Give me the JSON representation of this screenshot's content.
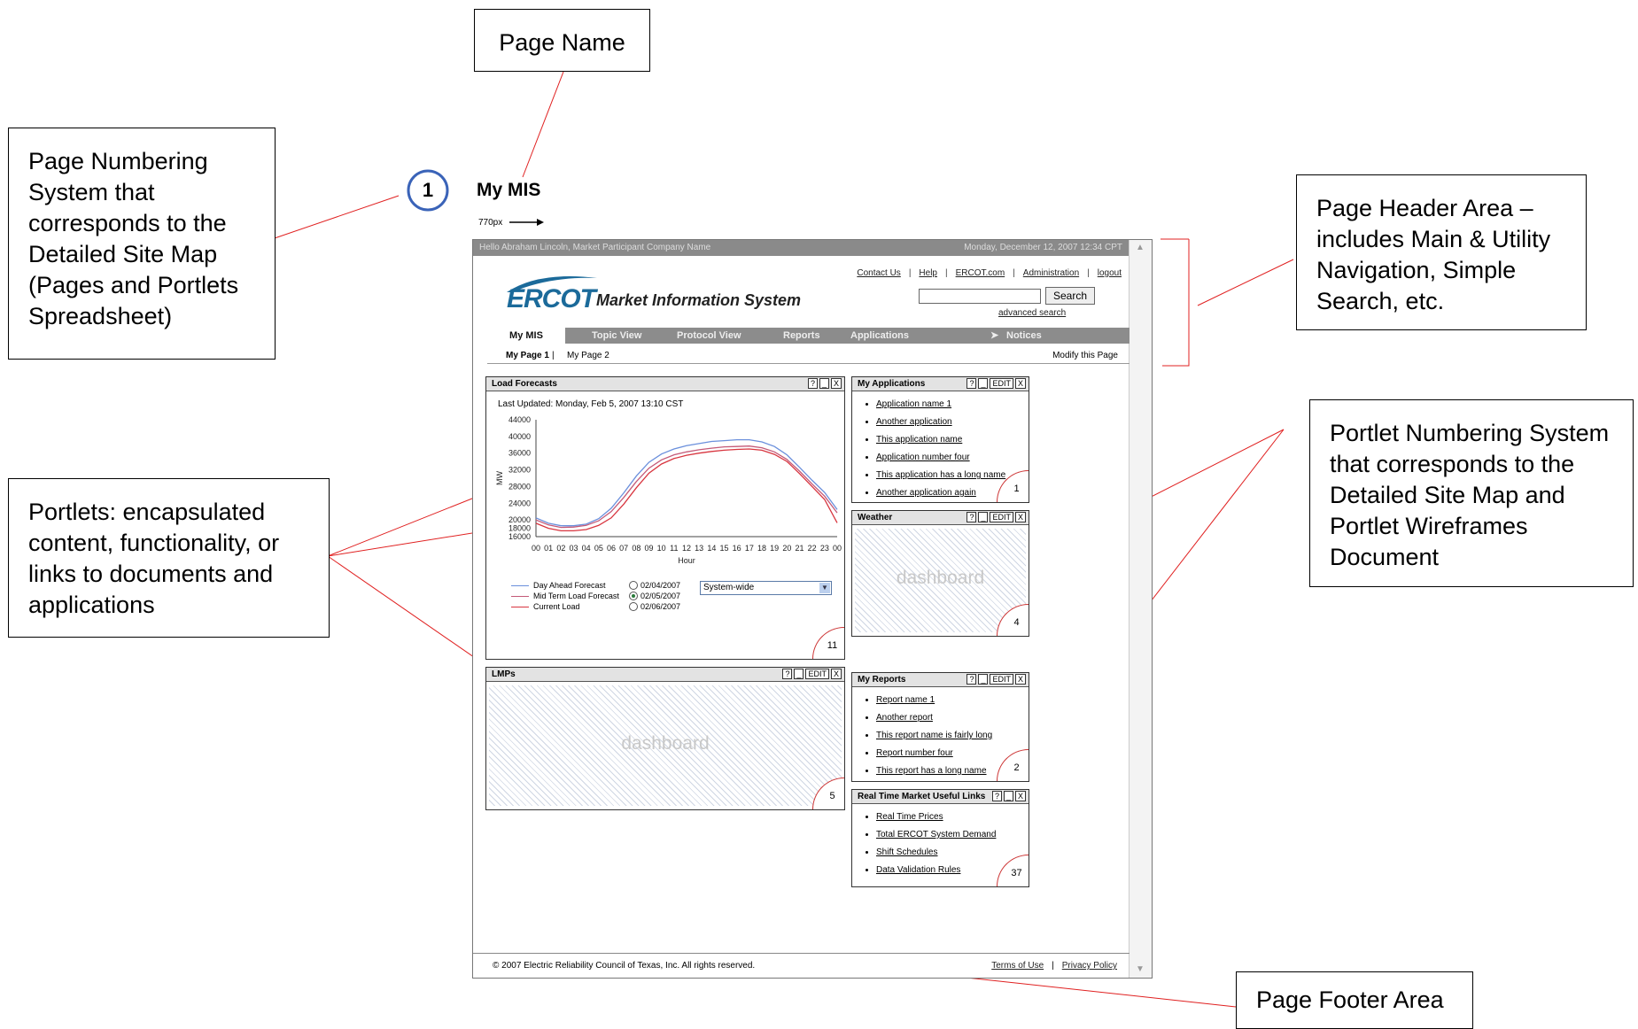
{
  "annotations": {
    "page_name": "Page Name",
    "page_numbering": "Page Numbering System that corresponds to the Detailed Site Map (Pages and Portlets Spreadsheet)",
    "page_header_area": "Page Header Area – includes Main & Utility Navigation, Simple Search, etc.",
    "portlets": "Portlets: encapsulated content, functionality, or links to documents and applications",
    "portlet_numbering": "Portlet Numbering System that corresponds to the Detailed Site Map and Portlet Wireframes Document",
    "page_footer_area": "Page Footer Area"
  },
  "page": {
    "number": "1",
    "title": "My MIS",
    "width_label": "770px"
  },
  "topbar": {
    "greeting": "Hello Abraham Lincoln, Market Participant Company Name",
    "datetime": "Monday, December 12, 2007   12:34 CPT"
  },
  "utility_nav": [
    "Contact Us",
    "Help",
    "ERCOT.com",
    "Administration",
    "logout"
  ],
  "search": {
    "button": "Search",
    "advanced": "advanced search",
    "value": ""
  },
  "logo": {
    "name": "ERCOT",
    "subtitle": "Market Information System"
  },
  "main_nav": {
    "items": [
      "My MIS",
      "Topic View",
      "Protocol View",
      "Reports",
      "Applications"
    ],
    "notices": "Notices",
    "active": "My MIS"
  },
  "sub_nav": {
    "page1": "My Page 1",
    "separator": "|",
    "page2": "My Page 2",
    "modify": "Modify this Page"
  },
  "portlets": {
    "load_forecasts": {
      "title": "Load Forecasts",
      "last_updated": "Last Updated: Monday, Feb 5, 2007  13:10 CST",
      "number": "11",
      "dates": [
        "02/04/2007",
        "02/05/2007",
        "02/06/2007"
      ],
      "selected_date": "02/05/2007",
      "region": "System-wide"
    },
    "lmps": {
      "title": "LMPs",
      "placeholder": "dashboard",
      "number": "5"
    },
    "my_applications": {
      "title": "My Applications",
      "number": "1",
      "items": [
        "Application name 1",
        "Another application",
        "This application name",
        "Application number four",
        "This application has a long name",
        "Another application again"
      ]
    },
    "weather": {
      "title": "Weather",
      "placeholder": "dashboard",
      "number": "4"
    },
    "my_reports": {
      "title": "My Reports",
      "number": "2",
      "items": [
        "Report name 1",
        "Another report",
        "This report name is fairly long",
        "Report number four",
        "This report has a long name"
      ]
    },
    "rtm_links": {
      "title": "Real Time Market Useful Links",
      "number": "37",
      "items": [
        "Real Time Prices",
        "Total ERCOT System Demand",
        "Shift Schedules",
        "Data Validation Rules"
      ]
    },
    "buttons": {
      "help": "?",
      "min": "_",
      "edit": "EDIT",
      "close": "X"
    }
  },
  "chart_data": {
    "type": "line",
    "xlabel": "Hour",
    "ylabel": "MW",
    "x": [
      "00",
      "01",
      "02",
      "03",
      "04",
      "05",
      "06",
      "07",
      "08",
      "09",
      "10",
      "11",
      "12",
      "13",
      "14",
      "15",
      "16",
      "17",
      "18",
      "19",
      "20",
      "21",
      "22",
      "23",
      "00"
    ],
    "ylim": [
      16000,
      44000
    ],
    "yticks": [
      16000,
      18000,
      20000,
      24000,
      28000,
      32000,
      36000,
      40000,
      44000
    ],
    "series": [
      {
        "name": "Day Ahead Forecast",
        "color": "#6a8fdc",
        "values": [
          20500,
          19200,
          18600,
          18600,
          19000,
          20300,
          22800,
          26500,
          30500,
          33800,
          35800,
          37000,
          37800,
          38300,
          38800,
          39000,
          39200,
          39200,
          38700,
          37600,
          35600,
          32600,
          29500,
          26600,
          22500
        ]
      },
      {
        "name": "Mid Term Load Forecast",
        "color": "#c45a78",
        "values": [
          20000,
          18800,
          18200,
          18300,
          18700,
          19800,
          22000,
          25400,
          29200,
          32400,
          34400,
          35600,
          36300,
          36800,
          37200,
          37500,
          37600,
          37700,
          37300,
          36300,
          34500,
          31700,
          28600,
          25700,
          21700
        ]
      },
      {
        "name": "Current Load",
        "color": "#d8353f",
        "values": [
          19200,
          18000,
          17400,
          17400,
          17700,
          18700,
          20500,
          23800,
          27700,
          31200,
          33400,
          34700,
          35500,
          36000,
          36400,
          36700,
          36900,
          37000,
          36700,
          35700,
          34000,
          31100,
          28000,
          24900,
          19300
        ]
      }
    ]
  },
  "footer": {
    "copyright": "© 2007 Electric Reliability Council of Texas, Inc.  All rights reserved.",
    "links": [
      "Terms of Use",
      "Privacy Policy"
    ]
  }
}
